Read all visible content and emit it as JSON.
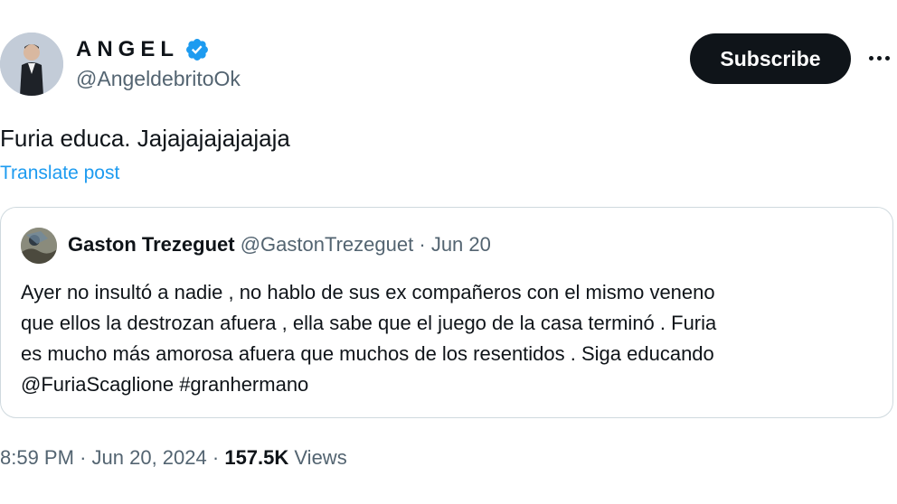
{
  "author": {
    "name": "ANGEL",
    "handle": "@AngeldebritoOk",
    "verified": true
  },
  "actions": {
    "subscribe_label": "Subscribe",
    "more_icon": "more-horizontal-icon"
  },
  "post": {
    "text": "Furia educa. Jajajajajajajaja",
    "translate_label": "Translate post"
  },
  "quoted_post": {
    "author_name": "Gaston Trezeguet",
    "author_handle": "@GastonTrezeguet",
    "separator": "·",
    "date": "Jun 20",
    "text_lines": [
      "Ayer no insultó a nadie , no hablo de sus ex compañeros con el mismo veneno",
      "que ellos la destrozan afuera , ella sabe que el juego de la casa terminó . Furia",
      "es mucho más amorosa afuera que muchos de los resentidos . Siga educando",
      "@FuriaScaglione #granhermano"
    ]
  },
  "meta": {
    "time": "8:59 PM",
    "separator": "·",
    "date": "Jun 20, 2024",
    "views_count": "157.5K",
    "views_label": "Views"
  },
  "colors": {
    "text": "#0f1419",
    "secondary": "#536471",
    "link": "#1d9bf0",
    "verified": "#1d9bf0",
    "border": "#cfd9de"
  }
}
